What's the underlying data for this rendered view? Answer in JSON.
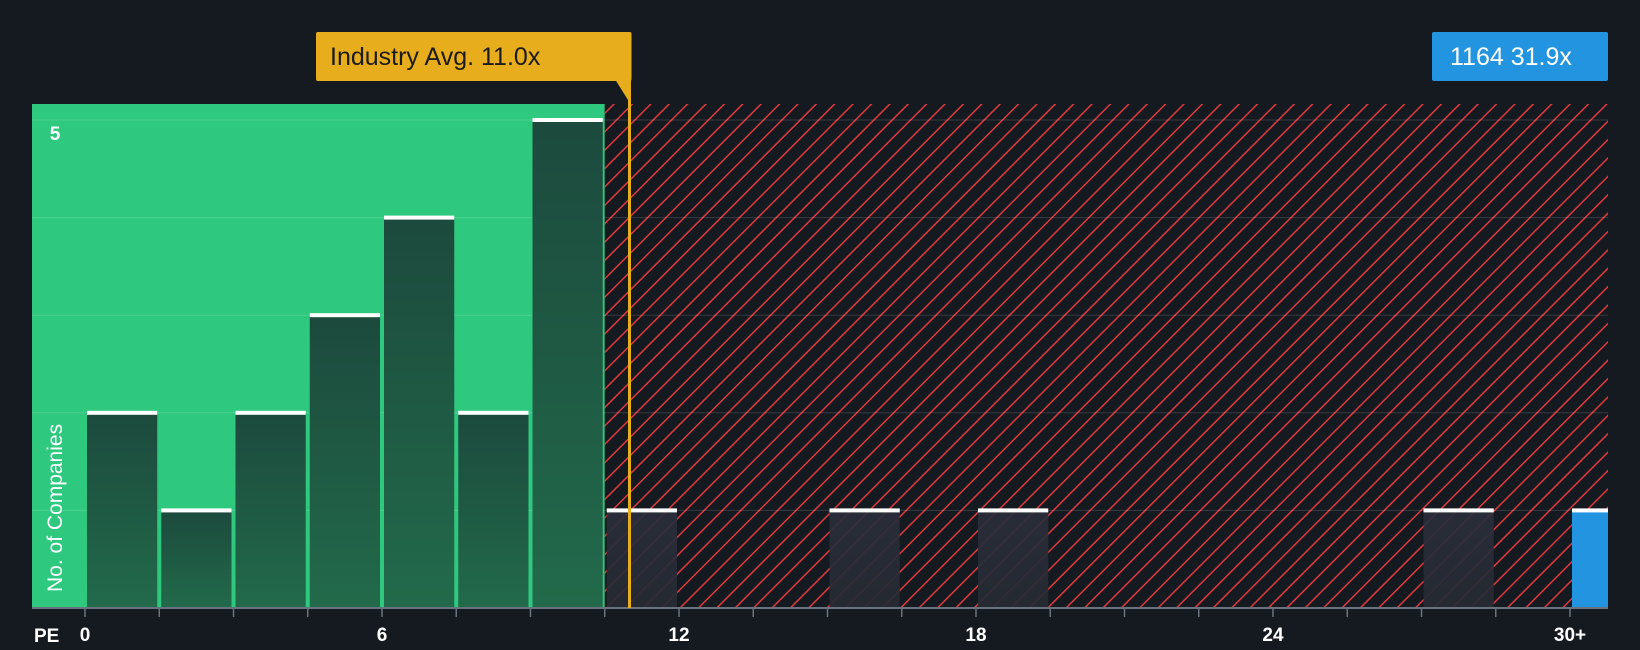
{
  "chart_data": {
    "type": "bar",
    "bin_width": 1.5,
    "bins": [
      {
        "x0": 0,
        "value": 2
      },
      {
        "x0": 1.5,
        "value": 1
      },
      {
        "x0": 3,
        "value": 2
      },
      {
        "x0": 4.5,
        "value": 3
      },
      {
        "x0": 6,
        "value": 4
      },
      {
        "x0": 7.5,
        "value": 2
      },
      {
        "x0": 9,
        "value": 5
      },
      {
        "x0": 10.5,
        "value": 1
      },
      {
        "x0": 15,
        "value": 1
      },
      {
        "x0": 18,
        "value": 1
      },
      {
        "x0": 27,
        "value": 1
      },
      {
        "x0": 30,
        "value": 1
      }
    ],
    "xlim": [
      0,
      30
    ],
    "ylim": [
      0,
      5
    ],
    "x_ticks": [
      0,
      6,
      12,
      18,
      24,
      30
    ],
    "x_tick_labels": [
      "0",
      "6",
      "12",
      "18",
      "24",
      "30+"
    ],
    "x_minor_step": 1.5,
    "y_ticks": [
      5
    ],
    "y_grid": [
      1,
      2,
      3,
      4,
      5
    ],
    "xlabel": "PE",
    "ylabel": "No. of Companies",
    "fair_value_pe": 10.5,
    "industry_avg": {
      "value": 11.0,
      "label": "Industry Avg. 11.0x"
    },
    "company": {
      "value": 31.9,
      "label": "1164 31.9x"
    },
    "legend": "none",
    "grid": true
  },
  "colors": {
    "background": "#151a21",
    "undervalued_zone": "#2ec97f",
    "bar_fill_top": "#1c4a3d",
    "bar_fill_bottom": "#226a4b",
    "bar_cap": "#ffffff",
    "overvalued_hatch": "#e0393e",
    "industry_accent": "#e8ad1c",
    "company_accent": "#2394e0",
    "axis": "#6a737d"
  }
}
